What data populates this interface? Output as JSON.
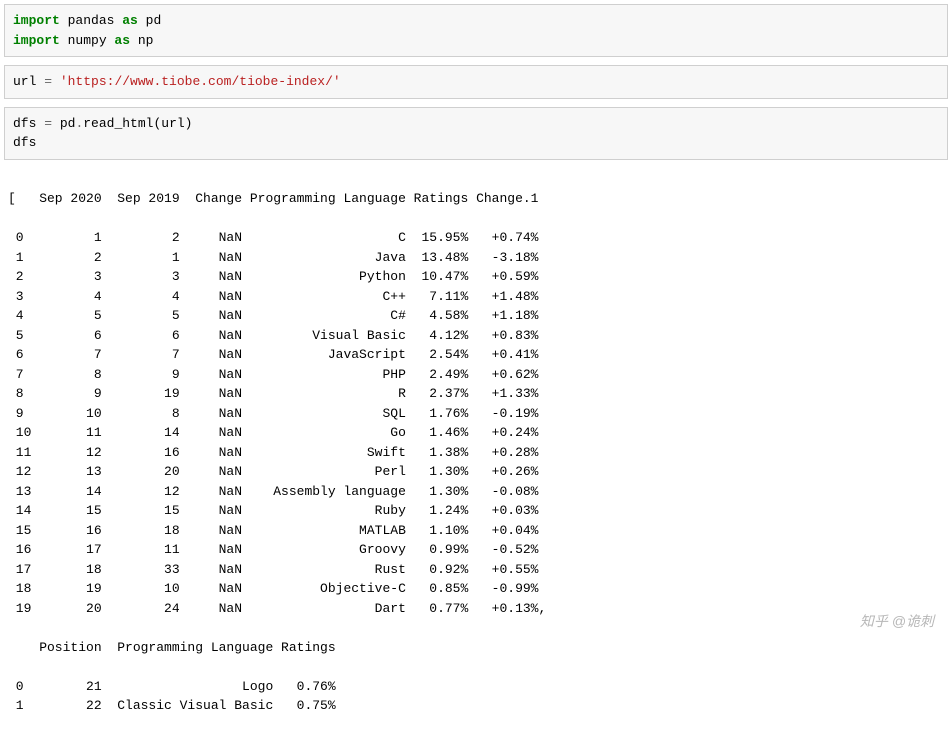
{
  "cell1": {
    "l1_kw1": "import",
    "l1_nm1": " pandas ",
    "l1_kw2": "as",
    "l1_nm2": " pd",
    "l2_kw1": "import",
    "l2_nm1": " numpy ",
    "l2_kw2": "as",
    "l2_nm2": " np"
  },
  "cell2": {
    "l1_nm1": "url ",
    "l1_op": "=",
    "l1_str": " 'https://www.tiobe.com/tiobe-index/'"
  },
  "cell3": {
    "l1_nm1": "dfs ",
    "l1_op": "=",
    "l1_nm2": " pd",
    "l1_op2": ".",
    "l1_nm3": "read_html",
    "l1_nm4": "(url)",
    "l2": "dfs"
  },
  "output": {
    "header": "[   Sep 2020  Sep 2019  Change Programming Language Ratings Change.1",
    "rows": [
      " 0         1         2     NaN                    C  15.95%   +0.74%",
      " 1         2         1     NaN                 Java  13.48%   -3.18%",
      " 2         3         3     NaN               Python  10.47%   +0.59%",
      " 3         4         4     NaN                  C++   7.11%   +1.48%",
      " 4         5         5     NaN                   C#   4.58%   +1.18%",
      " 5         6         6     NaN         Visual Basic   4.12%   +0.83%",
      " 6         7         7     NaN           JavaScript   2.54%   +0.41%",
      " 7         8         9     NaN                  PHP   2.49%   +0.62%",
      " 8         9        19     NaN                    R   2.37%   +1.33%",
      " 9        10         8     NaN                  SQL   1.76%   -0.19%",
      " 10       11        14     NaN                   Go   1.46%   +0.24%",
      " 11       12        16     NaN                Swift   1.38%   +0.28%",
      " 12       13        20     NaN                 Perl   1.30%   +0.26%",
      " 13       14        12     NaN    Assembly language   1.30%   -0.08%",
      " 14       15        15     NaN                 Ruby   1.24%   +0.03%",
      " 15       16        18     NaN               MATLAB   1.10%   +0.04%",
      " 16       17        11     NaN               Groovy   0.99%   -0.52%",
      " 17       18        33     NaN                 Rust   0.92%   +0.55%",
      " 18       19        10     NaN          Objective-C   0.85%   -0.99%",
      " 19       20        24     NaN                 Dart   0.77%   +0.13%,"
    ],
    "header2": "    Position  Programming Language Ratings",
    "rows2": [
      " 0        21                  Logo   0.76%",
      " 1        22  Classic Visual Basic   0.75%"
    ]
  },
  "watermark": "知乎 @诡刺"
}
